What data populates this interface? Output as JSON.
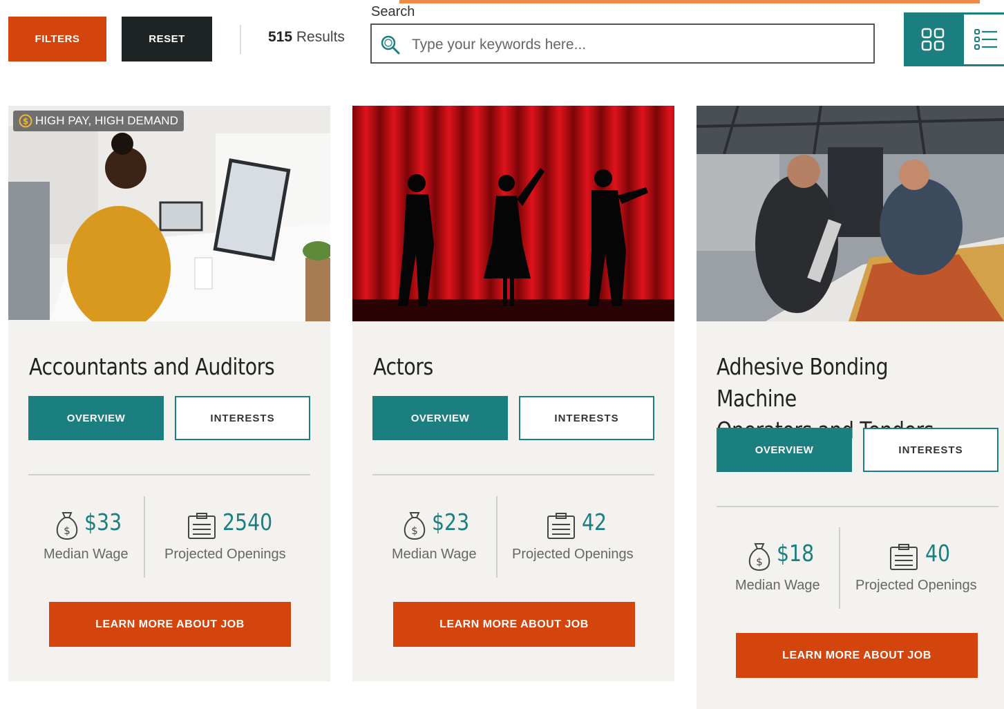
{
  "toolbar": {
    "filters_label": "FILTERS",
    "reset_label": "RESET",
    "results_count": "515",
    "results_label": "Results"
  },
  "search": {
    "label": "Search",
    "placeholder": "Type your keywords here..."
  },
  "view_toggle": {
    "grid_icon": "grid-icon",
    "list_icon": "list-icon"
  },
  "colors": {
    "accent_orange": "#d4440d",
    "accent_teal": "#1b7f80",
    "dark": "#1e2424",
    "card_bg": "#f4f2ee"
  },
  "cards": [
    {
      "badge": "HIGH PAY, HIGH DEMAND",
      "title": "Accountants and Auditors",
      "overview_label": "OVERVIEW",
      "interests_label": "INTERESTS",
      "wage": "$33",
      "wage_label": "Median Wage",
      "openings": "2540",
      "openings_label": "Projected Openings",
      "learn_label": "LEARN MORE ABOUT JOB"
    },
    {
      "title": "Actors",
      "overview_label": "OVERVIEW",
      "interests_label": "INTERESTS",
      "wage": "$23",
      "wage_label": "Median Wage",
      "openings": "42",
      "openings_label": "Projected Openings",
      "learn_label": "LEARN MORE ABOUT JOB"
    },
    {
      "title_line1": "Adhesive Bonding Machine",
      "title_line2": "Operators and Tenders",
      "overview_label": "OVERVIEW",
      "interests_label": "INTERESTS",
      "wage": "$18",
      "wage_label": "Median Wage",
      "openings": "40",
      "openings_label": "Projected Openings",
      "learn_label": "LEARN MORE ABOUT JOB"
    }
  ]
}
